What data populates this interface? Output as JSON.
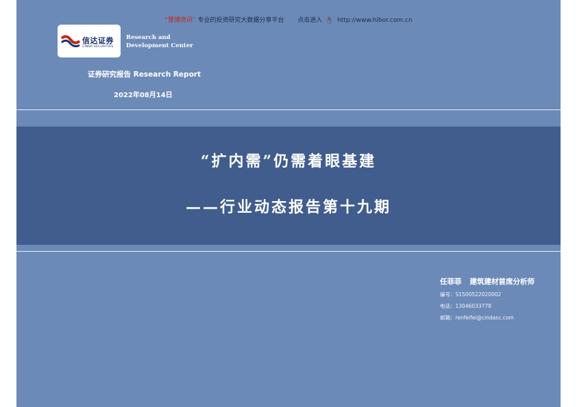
{
  "header": {
    "hibor_quote_name": "“慧博资讯”",
    "hibor_desc": "专业的投资研究大数据分享平台",
    "click_text": "点击进入",
    "url": "http://www.hibor.com.cn"
  },
  "logo": {
    "cn": "信达证券",
    "en": "CINDA SECURITIES"
  },
  "research_center": {
    "line1": "Research and",
    "line2": "Development Center"
  },
  "report_type": "证券研究报告  Research Report",
  "report_date": "2022年08月14日",
  "title": {
    "main": "“扩内需”仍需着眼基建",
    "sub": "——行业动态报告第十九期"
  },
  "analyst": {
    "name": "任菲菲",
    "role": "建筑建材首席分析师",
    "id_line": "编号：S1500522020002",
    "phone_line": "电话：13046033778",
    "email_line": "邮箱：renfeifei@cindasc.com"
  },
  "colors": {
    "page_bg": "#6c8ab8",
    "title_band": "#405d8d",
    "brand_red": "#c0261c",
    "brand_blue": "#1a2f6c"
  }
}
